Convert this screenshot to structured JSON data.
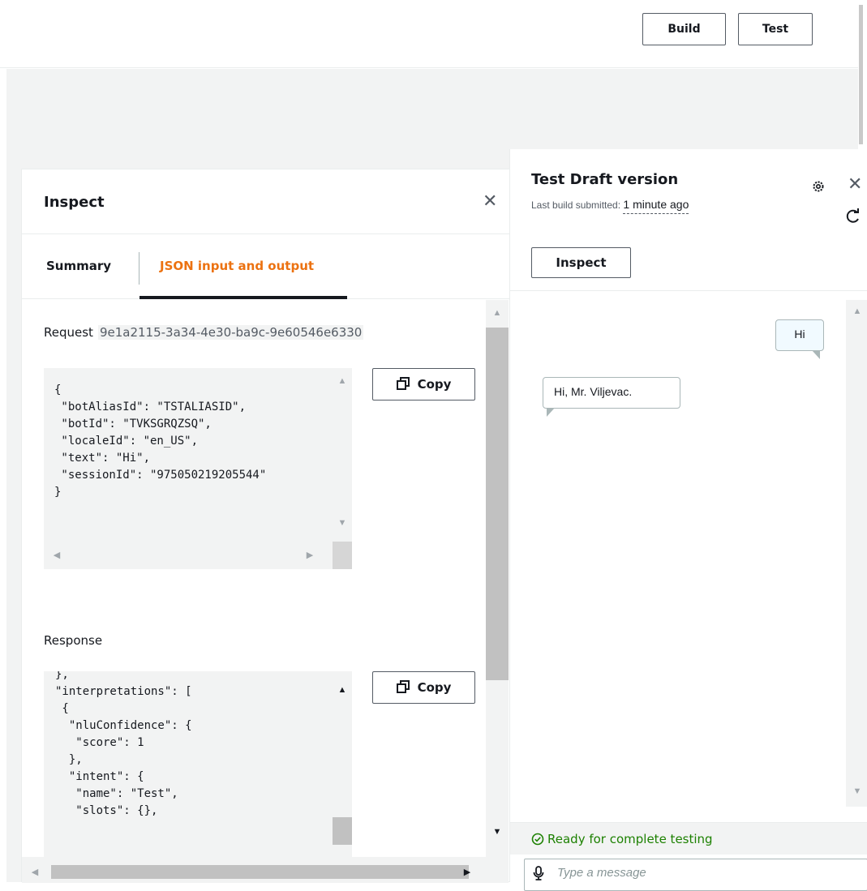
{
  "header": {
    "build_label": "Build",
    "test_label": "Test"
  },
  "inspect": {
    "title": "Inspect",
    "tabs": [
      {
        "label": "Summary",
        "selected": false
      },
      {
        "label": "JSON input and output",
        "selected": true
      }
    ],
    "request_label": "Request",
    "request_id": "9e1a2115-3a34-4e30-ba9c-9e60546e6330",
    "request_json": "{\n \"botAliasId\": \"TSTALIASID\",\n \"botId\": \"TVKSGRQZSQ\",\n \"localeId\": \"en_US\",\n \"text\": \"Hi\",\n \"sessionId\": \"975050219205544\"\n}",
    "response_label": "Response",
    "response_json": "},\n\"interpretations\": [\n {\n  \"nluConfidence\": {\n   \"score\": 1\n  },\n  \"intent\": {\n   \"name\": \"Test\",\n   \"slots\": {},",
    "copy_label": "Copy",
    "icons": {
      "close": "close-icon",
      "copy": "copy-icon"
    }
  },
  "test_panel": {
    "title": "Test Draft version",
    "last_build_prefix": "Last build submitted: ",
    "last_build_ago": "1 minute ago",
    "inspect_button": "Inspect",
    "icons": {
      "settings": "gear-icon",
      "close": "close-icon",
      "refresh": "refresh-icon",
      "mic": "microphone-icon",
      "ready": "check-circle-icon"
    },
    "messages": [
      {
        "from": "user",
        "text": "Hi"
      },
      {
        "from": "bot",
        "text": "Hi, Mr. Viljevac."
      }
    ],
    "status": "Ready for complete testing",
    "status_color": "#1d8102",
    "message_placeholder": "Type a message"
  },
  "colors": {
    "accent": "#ec7211",
    "text": "#16191f",
    "background": "#f2f3f3"
  }
}
